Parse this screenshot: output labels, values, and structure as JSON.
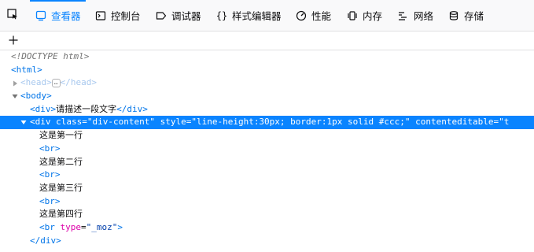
{
  "tabs": [
    {
      "label": "查看器",
      "icon": "inspector-icon"
    },
    {
      "label": "控制台",
      "icon": "console-icon"
    },
    {
      "label": "调试器",
      "icon": "debugger-icon"
    },
    {
      "label": "样式编辑器",
      "icon": "style-editor-icon"
    },
    {
      "label": "性能",
      "icon": "performance-icon"
    },
    {
      "label": "内存",
      "icon": "memory-icon"
    },
    {
      "label": "网络",
      "icon": "network-icon"
    },
    {
      "label": "存储",
      "icon": "storage-icon"
    }
  ],
  "colors": {
    "accent": "#0a84ff",
    "tag": "#0074e8",
    "attr_name": "#dd00a9",
    "attr_value": "#003eaa"
  },
  "markup": {
    "doctype": "<!DOCTYPE html>",
    "html_open": "<html>",
    "head_open": "<head>",
    "head_close": "</head>",
    "body_open": "<body>",
    "div1_open": "<div>",
    "div1_text": "请描述一段文字",
    "div1_close": "</div>",
    "div2": {
      "open": "<div",
      "attr1_name": "class",
      "attr1_value": "\"div-content\"",
      "attr2_name": "style",
      "attr2_value": "\"line-height:30px; border:1px solid #ccc;\"",
      "attr3_name": "contenteditable",
      "attr3_value": "\"t"
    },
    "lines": [
      "这是第一行",
      "这是第二行",
      "这是第三行",
      "这是第四行"
    ],
    "br": "<br>",
    "br_last": "<br",
    "br_last_attr_name": "type",
    "br_last_attr_value": "\"_moz\"",
    "br_last_close": ">",
    "div2_close": "</div>"
  }
}
